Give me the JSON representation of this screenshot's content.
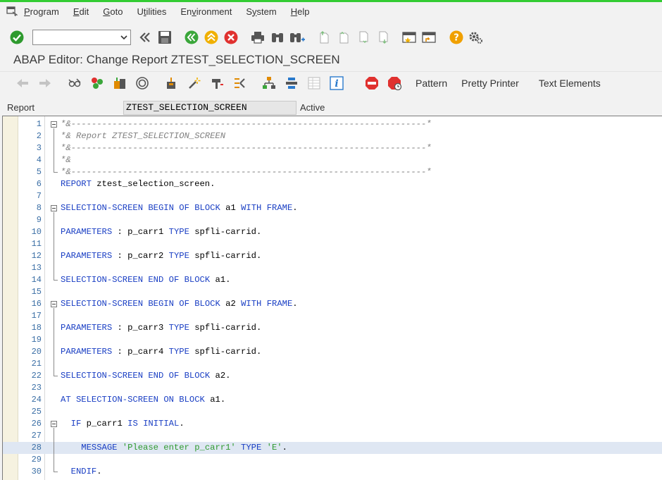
{
  "menubar": {
    "items": [
      {
        "label": "Program",
        "underline": "P"
      },
      {
        "label": "Edit",
        "underline": "E"
      },
      {
        "label": "Goto",
        "underline": "G"
      },
      {
        "label": "Utilities",
        "underline": "t"
      },
      {
        "label": "Environment",
        "underline": "v"
      },
      {
        "label": "System",
        "underline": "y"
      },
      {
        "label": "Help",
        "underline": "H"
      }
    ]
  },
  "toolbar": {
    "command_field_value": "",
    "icons": [
      "enter-check-icon",
      "command-field-dropdown",
      "collapse-icon",
      "save-icon",
      "back-icon",
      "exit-icon",
      "cancel-icon",
      "print-icon",
      "find-icon",
      "find-next-icon",
      "first-page-icon",
      "previous-page-icon",
      "next-page-icon",
      "last-page-icon",
      "new-session-icon",
      "shortcut-icon",
      "help-icon",
      "customize-layout-icon"
    ],
    "colors": {
      "check": "#2e9a2e",
      "nav_green": "#3aa63a",
      "exit_yellow": "#f0b000",
      "cancel_red": "#e0312f",
      "help_orange": "#f0a000"
    }
  },
  "title": "ABAP Editor: Change Report ZTEST_SELECTION_SCREEN",
  "appbar": {
    "buttons": {
      "pattern": "Pattern",
      "pretty_printer": "Pretty Printer",
      "text_elements": "Text Elements"
    }
  },
  "report": {
    "label": "Report",
    "name": "ZTEST_SELECTION_SCREEN",
    "status": "Active"
  },
  "editor": {
    "highlight_line": 28,
    "lines": [
      {
        "n": "1",
        "text": "*&---------------------------------------------------------------------*"
      },
      {
        "n": "2",
        "text": "*& Report ZTEST_SELECTION_SCREEN"
      },
      {
        "n": "3",
        "text": "*&---------------------------------------------------------------------*"
      },
      {
        "n": "4",
        "text": "*&"
      },
      {
        "n": "5",
        "text": "*&---------------------------------------------------------------------*"
      },
      {
        "n": "6",
        "text": "REPORT ztest_selection_screen."
      },
      {
        "n": "7",
        "text": ""
      },
      {
        "n": "8",
        "text": "SELECTION-SCREEN BEGIN OF BLOCK a1 WITH FRAME."
      },
      {
        "n": "9",
        "text": ""
      },
      {
        "n": "10",
        "text": "PARAMETERS : p_carr1 TYPE spfli-carrid."
      },
      {
        "n": "11",
        "text": ""
      },
      {
        "n": "12",
        "text": "PARAMETERS : p_carr2 TYPE spfli-carrid."
      },
      {
        "n": "13",
        "text": ""
      },
      {
        "n": "14",
        "text": "SELECTION-SCREEN END OF BLOCK a1."
      },
      {
        "n": "15",
        "text": ""
      },
      {
        "n": "16",
        "text": "SELECTION-SCREEN BEGIN OF BLOCK a2 WITH FRAME."
      },
      {
        "n": "17",
        "text": ""
      },
      {
        "n": "18",
        "text": "PARAMETERS : p_carr3 TYPE spfli-carrid."
      },
      {
        "n": "19",
        "text": ""
      },
      {
        "n": "20",
        "text": "PARAMETERS : p_carr4 TYPE spfli-carrid."
      },
      {
        "n": "21",
        "text": ""
      },
      {
        "n": "22",
        "text": "SELECTION-SCREEN END OF BLOCK a2."
      },
      {
        "n": "23",
        "text": ""
      },
      {
        "n": "24",
        "text": "AT SELECTION-SCREEN ON BLOCK a1."
      },
      {
        "n": "25",
        "text": ""
      },
      {
        "n": "26",
        "text": "  IF p_carr1 IS INITIAL."
      },
      {
        "n": "27",
        "text": ""
      },
      {
        "n": "28",
        "text": "    MESSAGE 'Please enter p_carr1' TYPE 'E'."
      },
      {
        "n": "29",
        "text": ""
      },
      {
        "n": "30",
        "text": "  ENDIF."
      }
    ]
  }
}
